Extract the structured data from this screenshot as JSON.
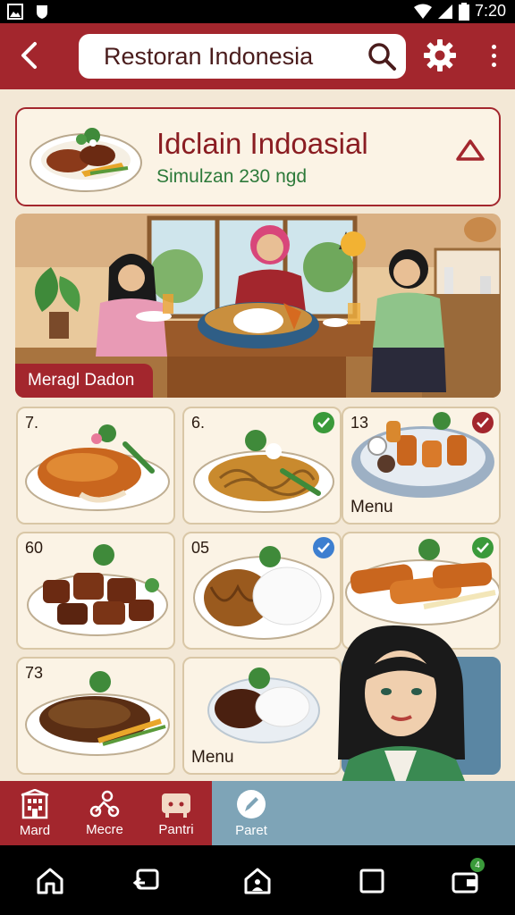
{
  "status_bar": {
    "time": "7:20"
  },
  "app_bar": {
    "search_value": "Restoran Indonesia",
    "back_icon": "chevron-left-icon",
    "settings_icon": "gear-icon",
    "more_icon": "kebab-icon"
  },
  "restaurant_card": {
    "title": "Idclain Indoasial",
    "subtitle": "Simulzan 230 ngd"
  },
  "banner": {
    "label": "Meragl Dadon"
  },
  "menu_items": [
    {
      "number": "7.",
      "label": "",
      "selected": false,
      "check_color": ""
    },
    {
      "number": "6.",
      "label": "",
      "selected": true,
      "check_color": "#3a9a3a"
    },
    {
      "number": "13",
      "label": "Menu",
      "selected": true,
      "check_color": "#a3262d"
    },
    {
      "number": "60",
      "label": "",
      "selected": false,
      "check_color": ""
    },
    {
      "number": "05",
      "label": "",
      "selected": true,
      "check_color": "#3d7fd0"
    },
    {
      "number": "",
      "label": "",
      "selected": true,
      "check_color": "#3a9a3a"
    },
    {
      "number": "73",
      "label": "",
      "selected": false,
      "check_color": ""
    },
    {
      "number": "",
      "label": "Menu",
      "selected": false,
      "check_color": ""
    }
  ],
  "bottom_nav": [
    {
      "label": "Mard",
      "icon": "building-icon"
    },
    {
      "label": "Mecre",
      "icon": "scooter-icon"
    },
    {
      "label": "Pantri",
      "icon": "cabinet-icon"
    },
    {
      "label": "Paret",
      "icon": "pencil-icon"
    }
  ],
  "colors": {
    "primary": "#a3262d",
    "background": "#f3e8d6",
    "accent_green": "#2d7a3a",
    "active_tab": "#7ea4b7"
  },
  "system_nav": {
    "notification_count": "4"
  }
}
